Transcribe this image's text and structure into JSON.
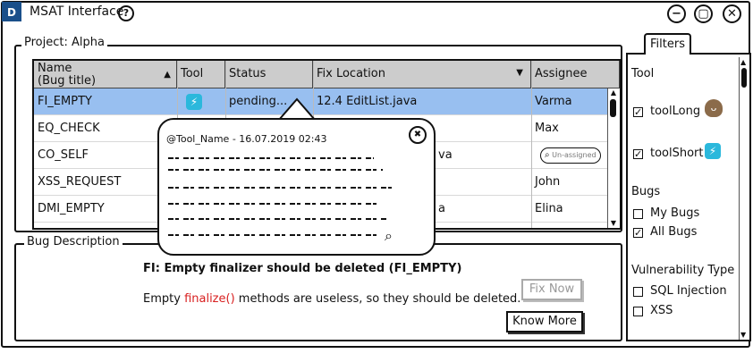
{
  "app": {
    "logo_text": "D",
    "title": "MSAT Interface",
    "help": "?"
  },
  "window_controls": {
    "minimize": "−",
    "restore": "▢",
    "close": "✕"
  },
  "project": {
    "label": "Project: Alpha"
  },
  "table": {
    "headers": {
      "name": "Name\n(Bug title)",
      "tool": "Tool",
      "status": "Status",
      "fix_location": "Fix Location",
      "assignee": "Assignee"
    },
    "rows": [
      {
        "name": "FI_EMPTY",
        "tool": "toolShort",
        "status": "pending...",
        "fix_location": "12.4 EditList.java",
        "assignee": "Varma",
        "selected": true
      },
      {
        "name": "EQ_CHECK",
        "tool": "",
        "status": "",
        "fix_location": "",
        "assignee": "Max",
        "selected": false
      },
      {
        "name": "CO_SELF",
        "tool": "",
        "status": "",
        "fix_location": "va",
        "assignee": "Un-assigned",
        "selected": false
      },
      {
        "name": "XSS_REQUEST",
        "tool": "",
        "status": "",
        "fix_location": "",
        "assignee": "John",
        "selected": false
      },
      {
        "name": "DMI_EMPTY",
        "tool": "",
        "status": "",
        "fix_location": "a",
        "assignee": "Elina",
        "selected": false
      }
    ]
  },
  "popup": {
    "header": "@Tool_Name - 16.07.2019 02:43"
  },
  "bug_description": {
    "label": "Bug Description",
    "title": "FI: Empty finalizer should be deleted (FI_EMPTY)",
    "text_before": "Empty ",
    "code": "finalize()",
    "text_after": " methods are useless, so they should be deleted.",
    "fix_now_label": "Fix Now",
    "know_more_label": "Know More",
    "code_color": "#d81f1f"
  },
  "filters": {
    "tab_label": "Filters",
    "tool_heading": "Tool",
    "tools": [
      {
        "label": "toolLong",
        "checked": true,
        "icon": "sloth-icon"
      },
      {
        "label": "toolShort",
        "checked": true,
        "icon": "lightning-icon"
      }
    ],
    "bugs_heading": "Bugs",
    "bugs": [
      {
        "label": "My Bugs",
        "checked": false
      },
      {
        "label": "All Bugs",
        "checked": true
      }
    ],
    "vuln_heading": "Vulnerability Type",
    "vulns": [
      {
        "label": "SQL Injection",
        "checked": false
      },
      {
        "label": "XSS",
        "checked": false
      }
    ]
  },
  "colors": {
    "selected_row": "#98bff0",
    "header_bg": "#cccccc",
    "tool_icon": "#2bb8dc"
  }
}
